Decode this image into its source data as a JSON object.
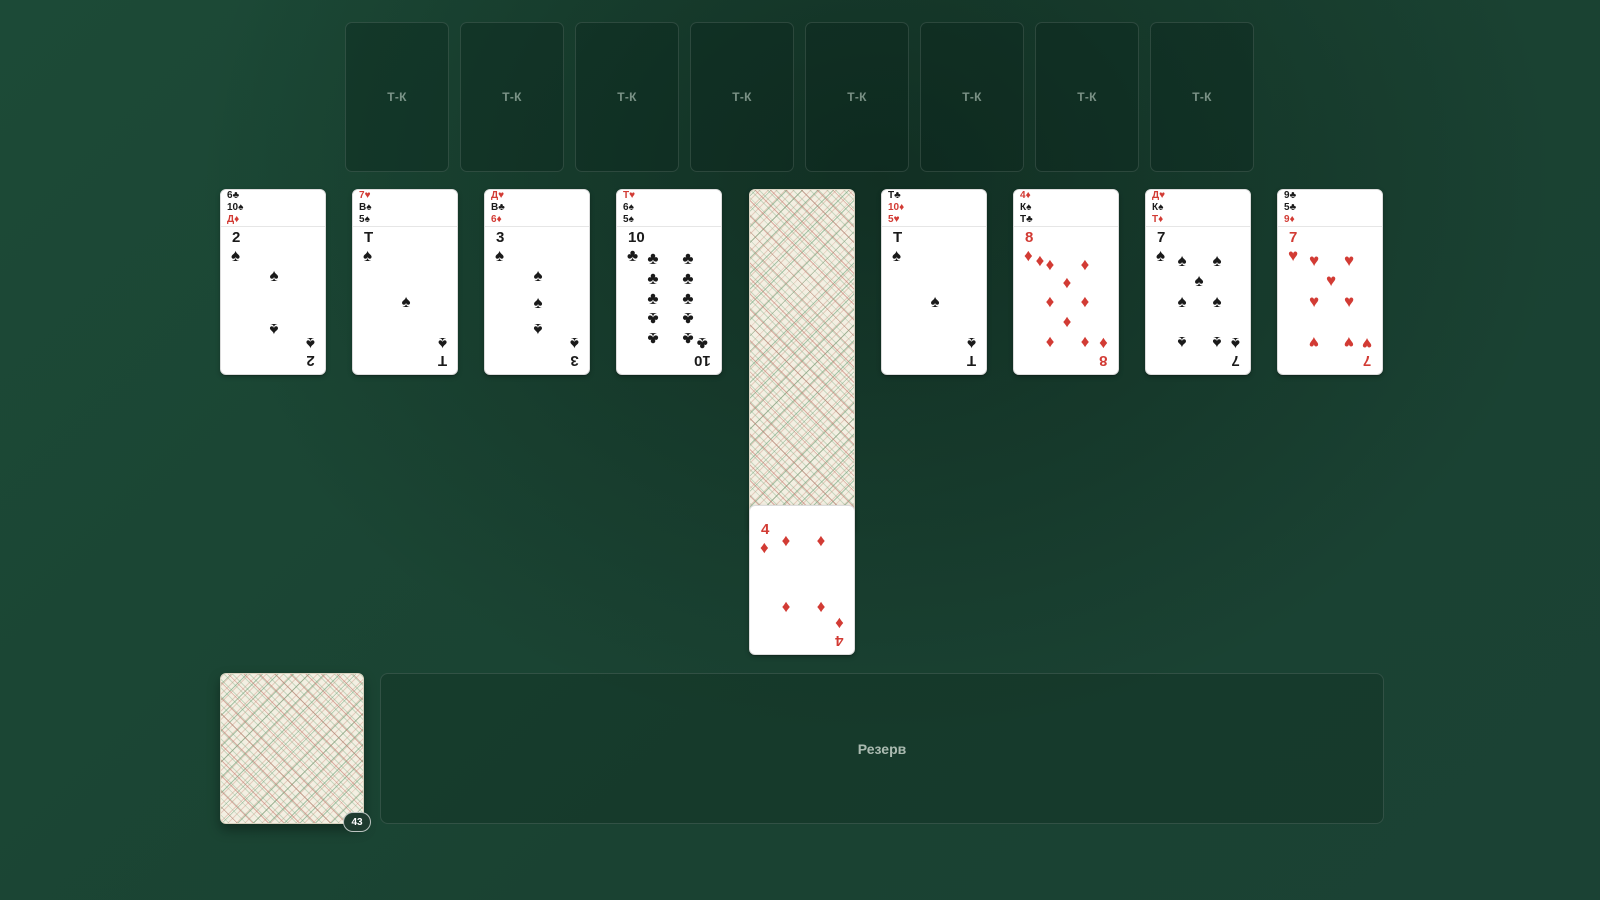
{
  "foundations": [
    "Т-К",
    "Т-К",
    "Т-К",
    "Т-К",
    "Т-К",
    "Т-К",
    "Т-К",
    "Т-К"
  ],
  "tableau": [
    {
      "hidden": [
        {
          "rank": "6",
          "suit": "♣"
        },
        {
          "rank": "10",
          "suit": "♠"
        },
        {
          "rank": "Д",
          "suit": "♦"
        }
      ],
      "top": {
        "rank": "2",
        "suit": "♠"
      }
    },
    {
      "hidden": [
        {
          "rank": "7",
          "suit": "♥"
        },
        {
          "rank": "В",
          "suit": "♠"
        },
        {
          "rank": "5",
          "suit": "♠"
        }
      ],
      "top": {
        "rank": "Т",
        "suit": "♠"
      }
    },
    {
      "hidden": [
        {
          "rank": "Д",
          "suit": "♥"
        },
        {
          "rank": "В",
          "suit": "♣"
        },
        {
          "rank": "6",
          "suit": "♦"
        }
      ],
      "top": {
        "rank": "3",
        "suit": "♠"
      }
    },
    {
      "hidden": [
        {
          "rank": "Т",
          "suit": "♥"
        },
        {
          "rank": "6",
          "suit": "♠"
        },
        {
          "rank": "5",
          "suit": "♠"
        }
      ],
      "top": {
        "rank": "10",
        "suit": "♣"
      }
    },
    {
      "hidden": [],
      "face_down_stack": true,
      "top": {
        "rank": "4",
        "suit": "♦"
      }
    },
    {
      "hidden": [
        {
          "rank": "Т",
          "suit": "♣"
        },
        {
          "rank": "10",
          "suit": "♦"
        },
        {
          "rank": "5",
          "suit": "♥"
        }
      ],
      "top": {
        "rank": "Т",
        "suit": "♠"
      }
    },
    {
      "hidden": [
        {
          "rank": "4",
          "suit": "♦"
        },
        {
          "rank": "К",
          "suit": "♠"
        },
        {
          "rank": "Т",
          "suit": "♣"
        }
      ],
      "top": {
        "rank": "8",
        "suit": "♦"
      }
    },
    {
      "hidden": [
        {
          "rank": "Д",
          "suit": "♥"
        },
        {
          "rank": "К",
          "suit": "♠"
        },
        {
          "rank": "Т",
          "suit": "♦"
        }
      ],
      "top": {
        "rank": "7",
        "suit": "♠"
      }
    },
    {
      "hidden": [
        {
          "rank": "9",
          "suit": "♣"
        },
        {
          "rank": "5",
          "suit": "♣"
        },
        {
          "rank": "9",
          "suit": "♦"
        }
      ],
      "top": {
        "rank": "7",
        "suit": "♥"
      }
    }
  ],
  "stock": {
    "count": "43"
  },
  "reserve": {
    "label": "Резерв"
  },
  "colors": {
    "red": "#d23b34",
    "black": "#1a1a1a",
    "table": "#1b4634"
  }
}
